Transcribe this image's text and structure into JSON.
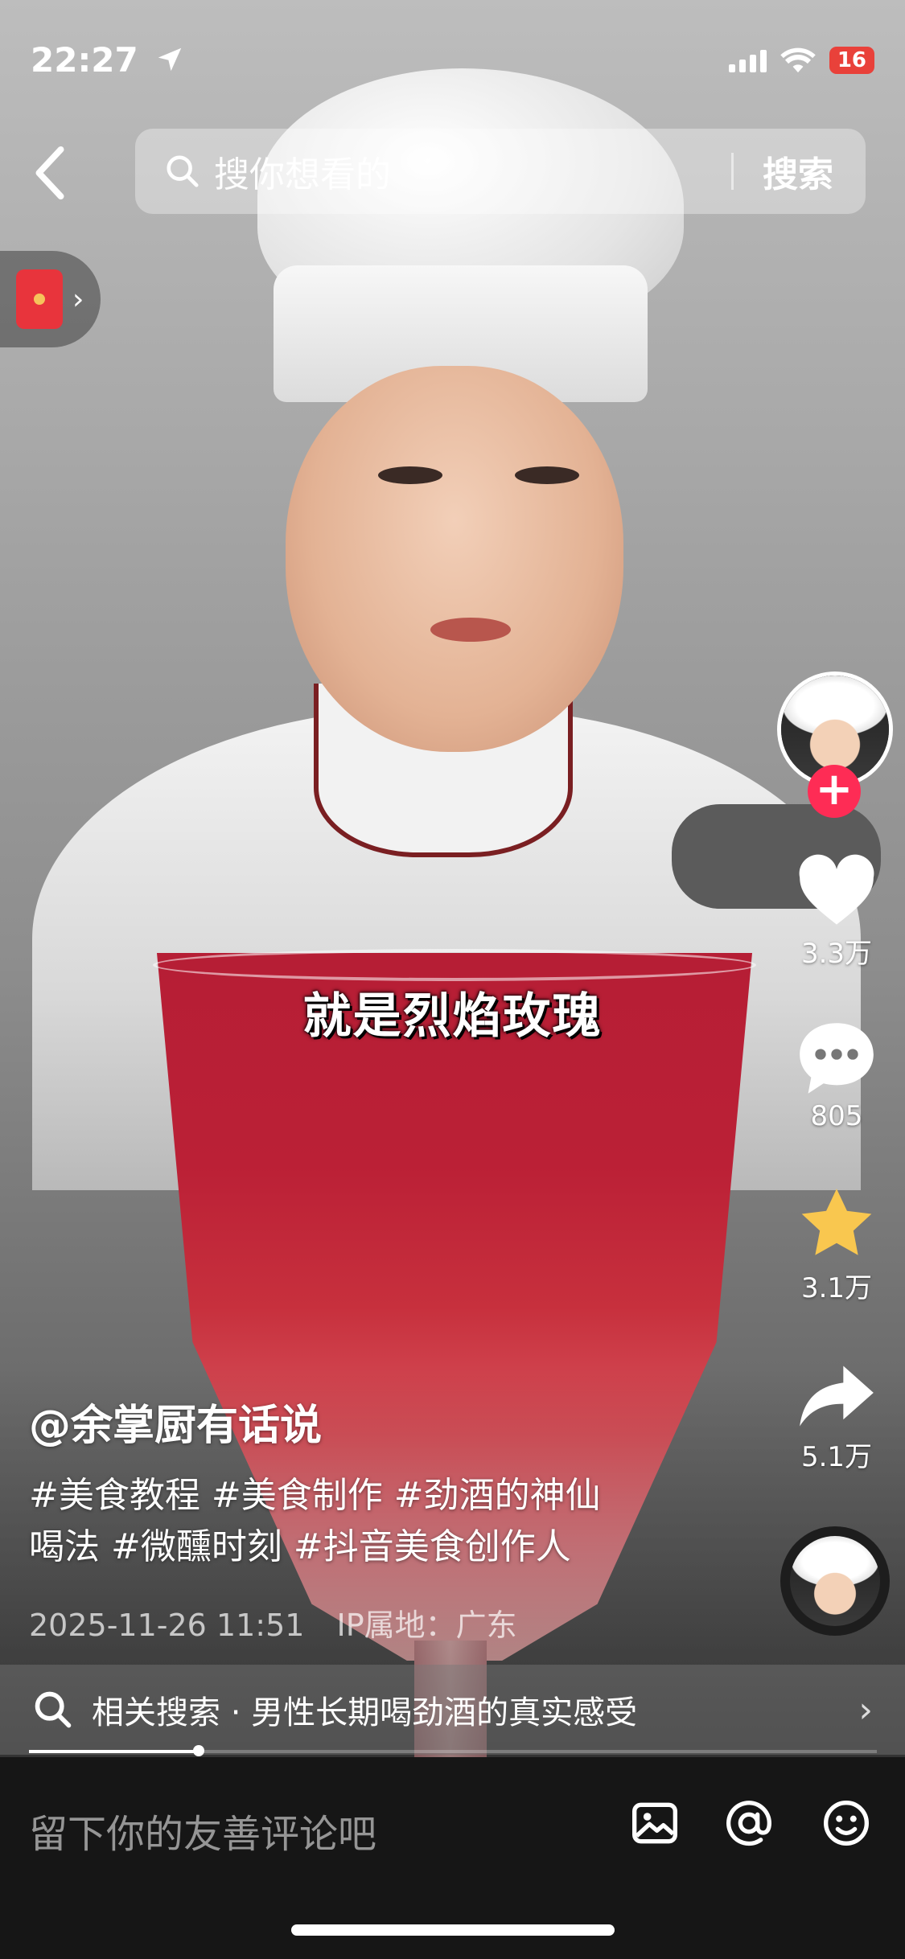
{
  "status_bar": {
    "time": "22:27",
    "battery": "16"
  },
  "search": {
    "placeholder": "搜你想看的",
    "button": "搜索"
  },
  "video": {
    "subtitle": "就是烈焰玫瑰"
  },
  "actions": {
    "likes": "3.3万",
    "comments": "805",
    "favorites": "3.1万",
    "shares": "5.1万"
  },
  "post": {
    "author": "@余掌厨有话说",
    "tags": [
      "#美食教程",
      "#美食制作",
      "#劲酒的神仙",
      "喝法",
      "#微醺时刻",
      "#抖音美食创作人"
    ],
    "date": "2025-11-26 11:51",
    "ip": "IP属地：广东"
  },
  "related": {
    "text": "相关搜索 · 男性长期喝劲酒的真实感受"
  },
  "playback": {
    "progress": 0.2
  },
  "comment": {
    "placeholder": "留下你的友善评论吧"
  },
  "icons": {
    "back": "chevron-left-icon",
    "search": "search-icon",
    "location": "location-arrow-icon",
    "like": "heart-icon",
    "comment": "comment-bubble-icon",
    "favorite": "star-icon",
    "share": "share-arrow-icon",
    "image": "image-icon",
    "mention": "at-icon",
    "emoji": "emoji-icon"
  },
  "colors": {
    "accent": "#fe2c55",
    "star": "#f9c74f",
    "battery": "#e9413a"
  }
}
